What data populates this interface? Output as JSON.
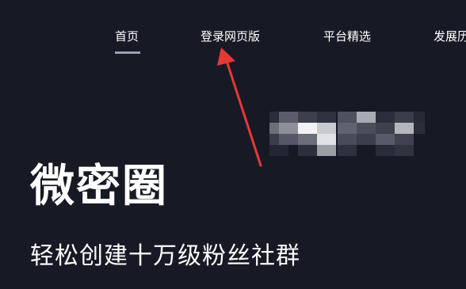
{
  "nav": {
    "items": [
      {
        "label": "首页",
        "active": true
      },
      {
        "label": "登录网页版"
      },
      {
        "label": "平台精选"
      },
      {
        "label": "发展历"
      }
    ]
  },
  "hero": {
    "title": "微密圈",
    "subtitle": "轻松创建十万级粉丝社群"
  },
  "colors": {
    "background": "#171a25",
    "text": "#ffffff",
    "annotation_arrow": "#e53935"
  }
}
